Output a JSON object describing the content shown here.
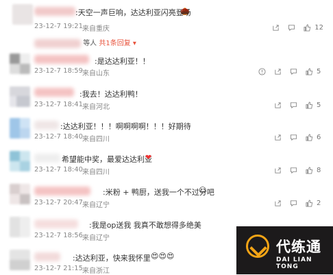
{
  "comments": [
    {
      "text": ":天空一声巨响，达达利亚闪亮登场",
      "time": "23-12-7 19:21",
      "location": "来自重庆",
      "likes": "12"
    },
    {
      "text": ":是达达利亚！！",
      "time": "23-12-7 18:59",
      "location": "来自山东",
      "likes": "5"
    },
    {
      "text": ":我去！达达利鸭！",
      "time": "23-12-7 18:41",
      "location": "来自河北",
      "likes": "5"
    },
    {
      "text": ":达达利亚！！！啊啊啊啊！！！好期待",
      "time": "23-12-7 18:40",
      "location": "来自四川",
      "likes": "6"
    },
    {
      "text": "希望能中奖，最爱达达利亚",
      "time": "23-12-7 18:40",
      "location": "来自四川",
      "likes": "8"
    },
    {
      "text": ":米粉 + 鸭厨，送我一个不过分吧",
      "time": "23-12-7 20:47",
      "location": "来自辽宁",
      "likes": "2"
    },
    {
      "text": ":我是op送我  我真不敢想得多绝美",
      "time": "23-12-7 18:56",
      "location": "来自辽宁",
      "likes": ""
    },
    {
      "text": ":达达利亚，快来我怀里",
      "time": "23-12-7 21:15",
      "location": "来自浙江",
      "likes": ""
    }
  ],
  "reply_bar": {
    "people_suffix": "等人",
    "more_label": "共1条回复 ▾"
  },
  "watermark": {
    "cn": "代练通",
    "en": "DAI LIAN TONG"
  },
  "colors": {
    "accent": "#e8533c",
    "logo_bg": "#1c1a1b",
    "logo_gold": "#f3a416"
  }
}
